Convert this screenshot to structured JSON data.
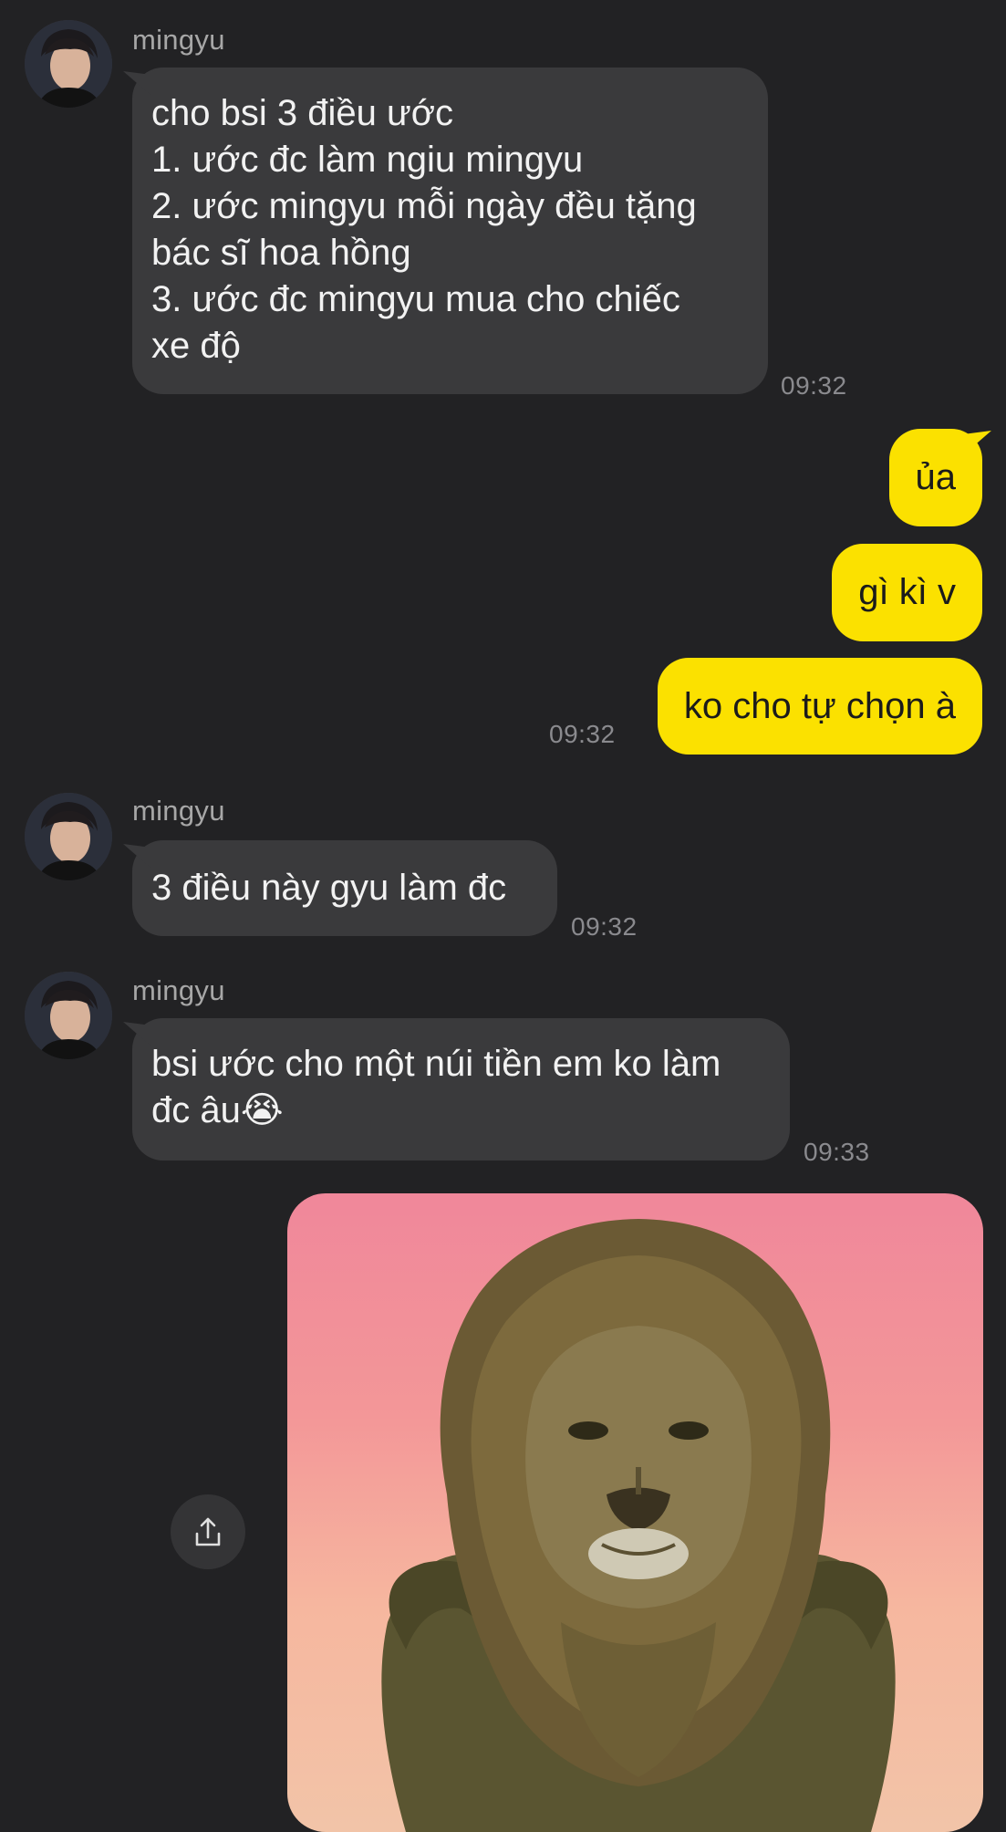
{
  "messages": [
    {
      "sender": "mingyu",
      "lines": [
        "cho bsi 3 điều ước",
        "1. ước đc làm ngiu mingyu",
        "2. ước mingyu mỗi ngày đều tặng",
        "bác sĩ hoa hồng",
        "3. ước đc mingyu mua cho chiếc",
        "xe độ"
      ],
      "time": "09:32"
    },
    {
      "sender": "me",
      "bubbles": [
        "ủa",
        "gì kì v",
        "ko cho tự chọn à"
      ],
      "time": "09:32"
    },
    {
      "sender": "mingyu",
      "lines": [
        "3 điều này gyu làm đc"
      ],
      "time": "09:32"
    },
    {
      "sender": "mingyu",
      "lines": [
        "bsi ước cho một núi tiền em ko làm",
        "đc âu😭"
      ],
      "time": "09:33"
    }
  ],
  "photo": {
    "subject": "lion with hands on hips"
  },
  "share_icon": "share-icon",
  "colors": {
    "background": "#222224",
    "incoming_bubble": "#3a3a3c",
    "outgoing_bubble": "#fbe100",
    "timestamp": "#8a8a8e"
  }
}
